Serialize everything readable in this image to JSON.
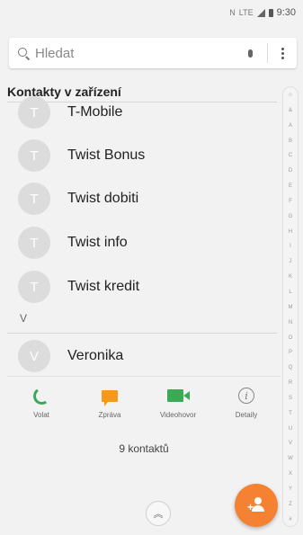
{
  "status_bar": {
    "icons": [
      "nfc-icon",
      "lte-icon",
      "signal-icon",
      "battery-icon"
    ],
    "nfc": "N",
    "lte": "LTE",
    "time": "9:30"
  },
  "search": {
    "placeholder": "Hledat",
    "icons": [
      "search-icon",
      "mic-icon",
      "more-options-icon"
    ]
  },
  "section_title": "Kontakty v zařízení",
  "contacts": [
    {
      "initial": "T",
      "name": "T-Mobile"
    },
    {
      "initial": "T",
      "name": "Twist Bonus"
    },
    {
      "initial": "T",
      "name": "Twist dobiti"
    },
    {
      "initial": "T",
      "name": "Twist info"
    },
    {
      "initial": "T",
      "name": "Twist kredit"
    },
    {
      "initial": "V",
      "name": "Veronika"
    }
  ],
  "letter_header": "V",
  "actions": [
    {
      "label": "Volat",
      "icon": "phone-icon",
      "color": "#3aa85a"
    },
    {
      "label": "Zpráva",
      "icon": "message-icon",
      "color": "#f39a1c"
    },
    {
      "label": "Videohovor",
      "icon": "video-icon",
      "color": "#3aaa55"
    },
    {
      "label": "Detaily",
      "icon": "info-icon",
      "color": "#888888"
    }
  ],
  "contact_count": "9 kontaktů",
  "fab": {
    "icon": "add-contact-icon",
    "color": "#f58233"
  },
  "scroll_top_icon": "chevron-up-icon",
  "index_letters": [
    "☆",
    "&",
    "A",
    "B",
    "C",
    "D",
    "E",
    "F",
    "G",
    "H",
    "I",
    "J",
    "K",
    "L",
    "M",
    "N",
    "O",
    "P",
    "Q",
    "R",
    "S",
    "T",
    "U",
    "V",
    "W",
    "X",
    "Y",
    "Z",
    "#"
  ]
}
